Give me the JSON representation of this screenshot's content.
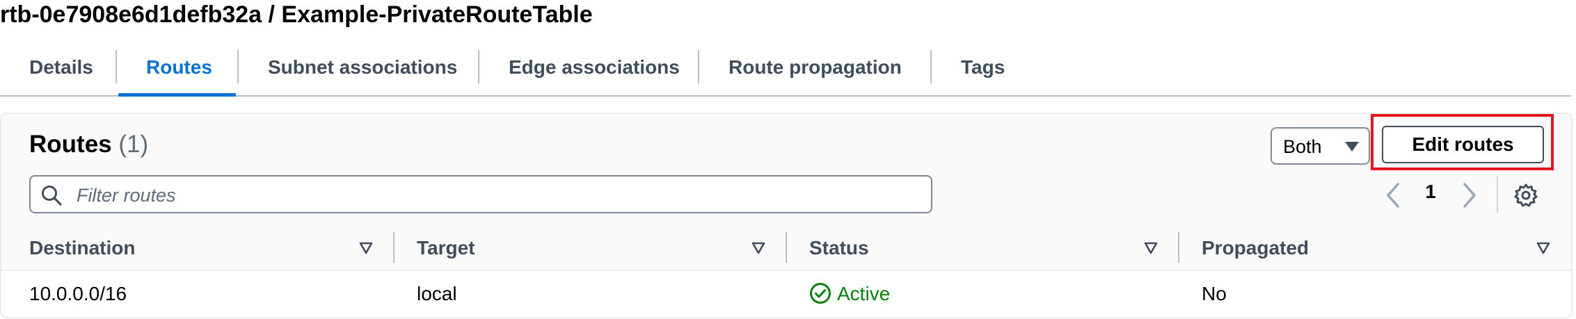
{
  "page": {
    "title": "rtb-0e7908e6d1defb32a / Example-PrivateRouteTable"
  },
  "tabs": [
    {
      "label": "Details",
      "active": false
    },
    {
      "label": "Routes",
      "active": true
    },
    {
      "label": "Subnet associations",
      "active": false
    },
    {
      "label": "Edge associations",
      "active": false
    },
    {
      "label": "Route propagation",
      "active": false
    },
    {
      "label": "Tags",
      "active": false
    }
  ],
  "routes_panel": {
    "title": "Routes",
    "count": "(1)",
    "filter_placeholder": "Filter routes",
    "filter_value": "",
    "view_select": {
      "selected": "Both"
    },
    "edit_button_label": "Edit routes",
    "pagination": {
      "current_page": "1"
    },
    "icons": {
      "search": "search-icon",
      "caret": "caret-down-icon",
      "prev": "chevron-left-icon",
      "next": "chevron-right-icon",
      "settings": "gear-icon",
      "sort": "sort-down-icon",
      "status": "check-circle-icon"
    }
  },
  "table": {
    "columns": [
      "Destination",
      "Target",
      "Status",
      "Propagated"
    ],
    "rows": [
      {
        "destination": "10.0.0.0/16",
        "target": "local",
        "status": "Active",
        "propagated": "No"
      }
    ]
  },
  "colors": {
    "accent": "#0972d3",
    "status_active": "#037f0c",
    "highlight": "#e3161c",
    "border": "#7d8998",
    "muted_text": "#414d5c"
  }
}
